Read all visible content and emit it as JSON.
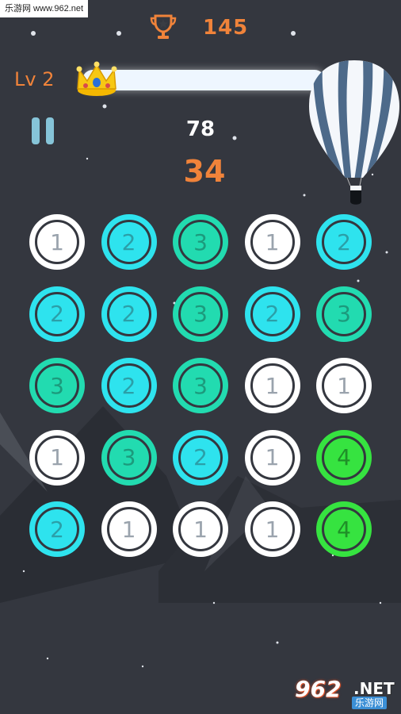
{
  "watermark_top": "乐游网 www.962.net",
  "header": {
    "trophy_icon": "trophy-icon",
    "best_score": "145",
    "level": "Lv 2",
    "level_progress": 0.0,
    "crown_icon": "crown-icon"
  },
  "hud": {
    "pause_icon": "pause-icon",
    "moves": "78",
    "score": "34"
  },
  "board": {
    "rows": 5,
    "cols": 5,
    "values": [
      [
        1,
        2,
        3,
        1,
        2
      ],
      [
        2,
        2,
        3,
        2,
        3
      ],
      [
        3,
        2,
        3,
        1,
        1
      ],
      [
        1,
        3,
        2,
        1,
        4
      ],
      [
        2,
        1,
        1,
        1,
        4
      ]
    ]
  },
  "colors": {
    "background": "#34373f",
    "accent": "#f0833a",
    "tile_1_fill": "#ffffff",
    "tile_2_fill": "#2ee3ee",
    "tile_3_fill": "#22dbb0",
    "tile_4_fill": "#36e340"
  },
  "watermark_bottom": {
    "brand": "962",
    "suffix": ".NET",
    "cn": "乐游网"
  }
}
